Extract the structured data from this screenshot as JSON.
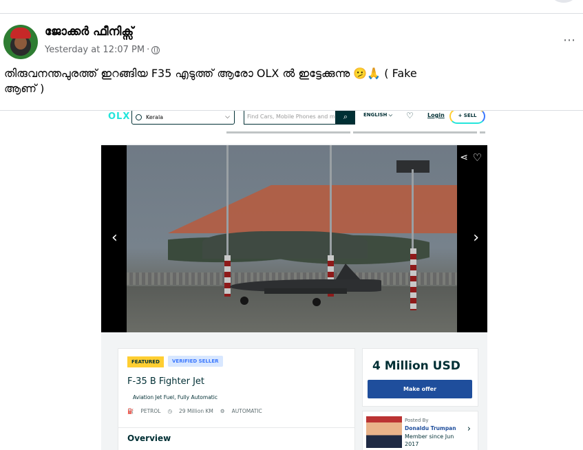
{
  "post": {
    "author": "ജോക്കർ ഫീനിക്സ്",
    "timestamp": "Yesterday at 12:07 PM",
    "separator": "·",
    "more_icon": "⋯",
    "caption_line1": "തിരുവനന്തപുരത്ത് ഇറങ്ങിയ F35 എടുത്ത് ആരോ OLX ൽ ഇട്ടേക്കുന്നു 🫤🙏 ( Fake",
    "caption_line2": "ആണ് )"
  },
  "olx": {
    "logo": "OLX",
    "location": "Kerala",
    "search_placeholder": "Find Cars, Mobile Phones and m",
    "search_icon": "🔍",
    "language": "ENGLISH",
    "login": "Login",
    "sell": "+ SELL",
    "gallery": {
      "prev": "‹",
      "next": "›",
      "share_icon": "⩤",
      "heart_icon": "♡"
    },
    "ad": {
      "featured": "FEATURED",
      "verified": "VERIFIED SELLER",
      "title": "F-35 B Fighter Jet",
      "description": "Aviation Jet Fuel, Fully Automatic",
      "fuel": "PETROL",
      "km": "29 Million KM",
      "transmission": "AUTOMATIC",
      "overview": "Overview"
    },
    "price": "4 Million USD",
    "make_offer": "Make offer",
    "seller": {
      "posted_by": "Posted By",
      "name": "Donaldu Trumpan",
      "member_since": "Member since Jun 2017",
      "chevron": "›"
    }
  }
}
